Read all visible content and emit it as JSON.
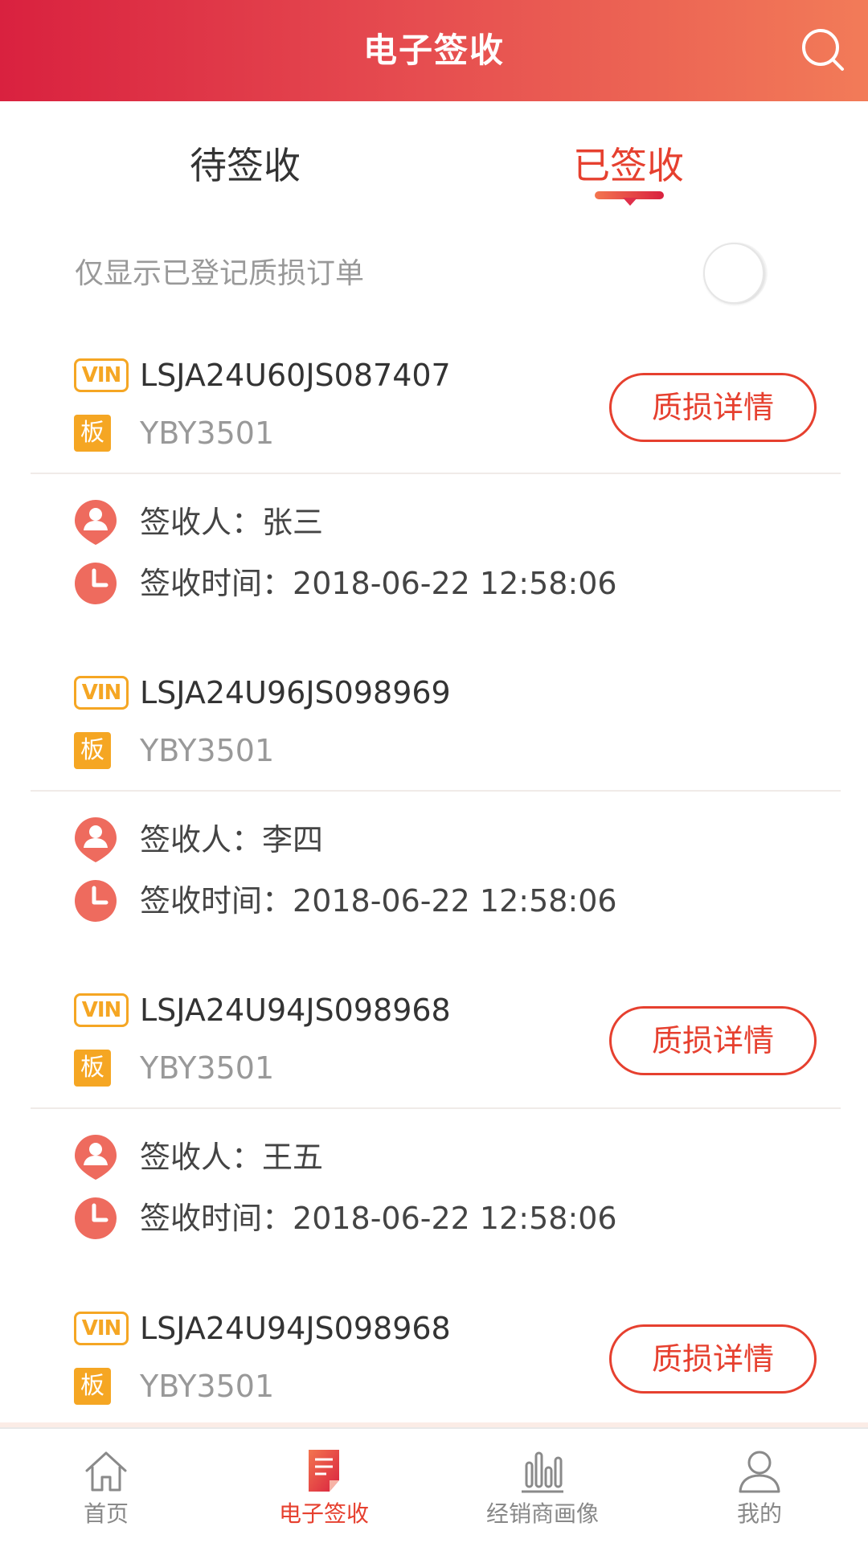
{
  "header": {
    "title": "电子签收",
    "search_icon": "search-icon"
  },
  "tabs": [
    {
      "label": "待签收",
      "active": false
    },
    {
      "label": "已签收",
      "active": true
    }
  ],
  "filter": {
    "label": "仅显示已登记质损订单",
    "enabled": false
  },
  "labels": {
    "vin_badge": "VIN",
    "plate_badge": "板",
    "damage_button": "质损详情",
    "receiver_prefix": "签收人：",
    "time_prefix": "签收时间："
  },
  "orders": [
    {
      "vin": "LSJA24U60JS087407",
      "plate": "YBY3501",
      "has_damage": true,
      "receiver": "张三",
      "time": "2018-06-22 12:58:06"
    },
    {
      "vin": "LSJA24U96JS098969",
      "plate": "YBY3501",
      "has_damage": false,
      "receiver": "李四",
      "time": "2018-06-22 12:58:06"
    },
    {
      "vin": "LSJA24U94JS098968",
      "plate": "YBY3501",
      "has_damage": true,
      "receiver": "王五",
      "time": "2018-06-22 12:58:06"
    },
    {
      "vin": "LSJA24U94JS098968",
      "plate": "YBY3501",
      "has_damage": true
    }
  ],
  "bottom_nav": [
    {
      "label": "首页",
      "icon": "home-icon",
      "active": false
    },
    {
      "label": "电子签收",
      "icon": "document-icon",
      "active": true
    },
    {
      "label": "经销商画像",
      "icon": "bar-chart-icon",
      "active": false
    },
    {
      "label": "我的",
      "icon": "user-icon",
      "active": false
    }
  ],
  "colors": {
    "header_start": "#d9213f",
    "header_end": "#f27b58",
    "accent": "#e6402f",
    "badge": "#f5a623",
    "icon": "#ee6b5e"
  }
}
